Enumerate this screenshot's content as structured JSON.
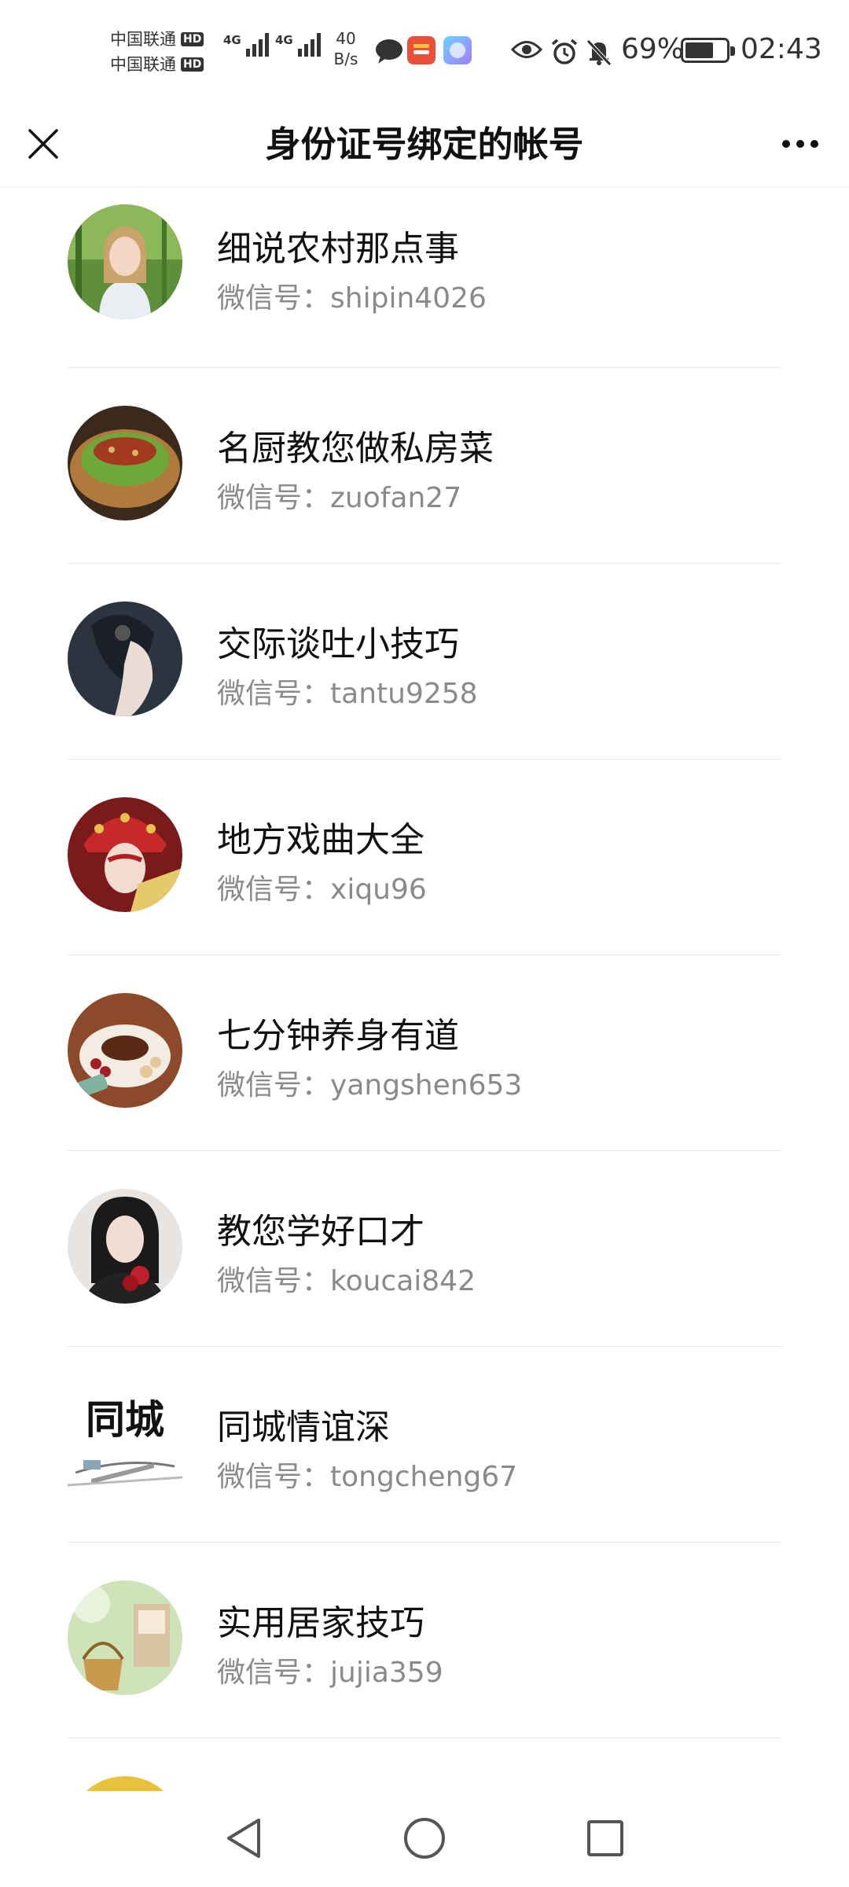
{
  "status_bar": {
    "carrier1": "中国联通",
    "carrier2": "中国联通",
    "hd_badge": "HD",
    "network_type": "4G",
    "net_speed_value": "40",
    "net_speed_unit": "B/s",
    "battery_percent": "69%",
    "battery_level": 0.69,
    "time": "02:43",
    "icons": [
      "message-icon",
      "app-icon-orange",
      "app-icon-gradient",
      "eye-icon",
      "alarm-icon",
      "mute-bell-icon",
      "battery-icon"
    ]
  },
  "nav": {
    "title": "身份证号绑定的帐号",
    "left_icon": "close-icon",
    "right_icon": "more-icon"
  },
  "accounts": [
    {
      "name": "细说农村那点事",
      "wechat_prefix": "微信号：",
      "wechat_id": "shipin4026"
    },
    {
      "name": "名厨教您做私房菜",
      "wechat_prefix": "微信号：",
      "wechat_id": "zuofan27"
    },
    {
      "name": "交际谈吐小技巧",
      "wechat_prefix": "微信号：",
      "wechat_id": "tantu9258"
    },
    {
      "name": "地方戏曲大全",
      "wechat_prefix": "微信号：",
      "wechat_id": "xiqu96"
    },
    {
      "name": "七分钟养身有道",
      "wechat_prefix": "微信号：",
      "wechat_id": "yangshen653"
    },
    {
      "name": "教您学好口才",
      "wechat_prefix": "微信号：",
      "wechat_id": "koucai842"
    },
    {
      "name": "同城情谊深",
      "wechat_prefix": "微信号：",
      "wechat_id": "tongcheng67",
      "avatar_text": "同城"
    },
    {
      "name": "实用居家技巧",
      "wechat_prefix": "微信号：",
      "wechat_id": "jujia359"
    }
  ],
  "system_nav": {
    "back_icon": "back-triangle-icon",
    "home_icon": "home-circle-icon",
    "recents_icon": "recents-square-icon"
  }
}
